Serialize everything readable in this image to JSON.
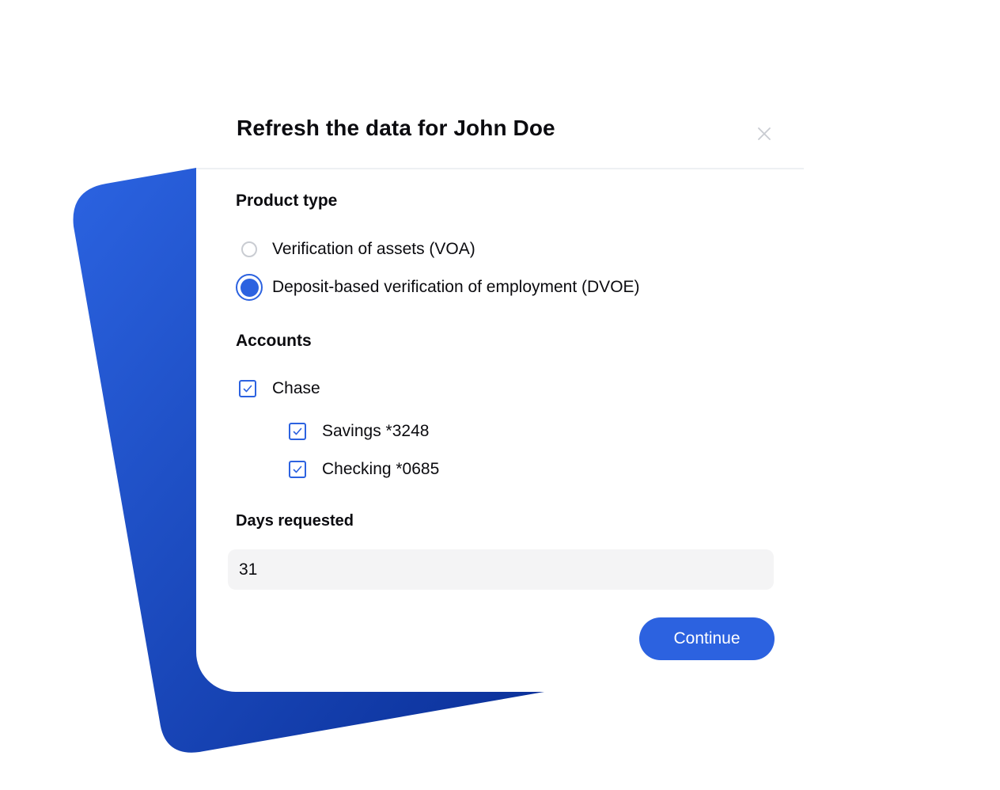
{
  "dialog": {
    "title": "Refresh the data for John Doe",
    "close_icon": "close-icon"
  },
  "product_type": {
    "label": "Product type",
    "options": [
      {
        "label": "Verification of assets (VOA)",
        "selected": false
      },
      {
        "label": "Deposit-based verification of employment (DVOE)",
        "selected": true
      }
    ]
  },
  "accounts": {
    "label": "Accounts",
    "institution": {
      "label": "Chase",
      "checked": true
    },
    "items": [
      {
        "label": "Savings *3248",
        "checked": true
      },
      {
        "label": "Checking *0685",
        "checked": true
      }
    ]
  },
  "days_requested": {
    "label": "Days requested",
    "value": "31"
  },
  "actions": {
    "continue_label": "Continue"
  },
  "colors": {
    "accent": "#2c62e0",
    "backdrop_light": "#2b63e1",
    "backdrop_dark": "#0a2f97",
    "input_background": "#f4f4f5"
  }
}
